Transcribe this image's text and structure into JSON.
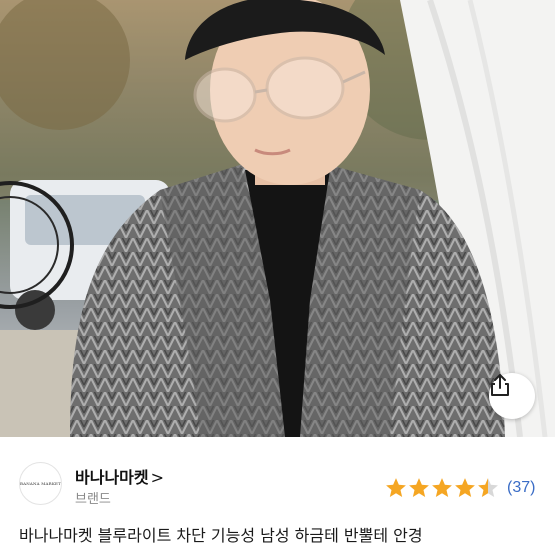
{
  "product_image": {
    "alt": "",
    "share_icon": "share-icon"
  },
  "brand": {
    "logo_text": "BANANA MARKET",
    "name": "바나나마켓",
    "chevron": ">",
    "type_label": "브랜드"
  },
  "rating": {
    "value": 4.5,
    "max": 5,
    "count_label": "(37)",
    "star_color": "#f5a623"
  },
  "product": {
    "title": "바나나마켓 블루라이트 차단 기능성 남성 하금테 반뿔테 안경"
  },
  "colors": {
    "link_blue": "#3b6dc6",
    "muted": "#8a8a8a"
  }
}
